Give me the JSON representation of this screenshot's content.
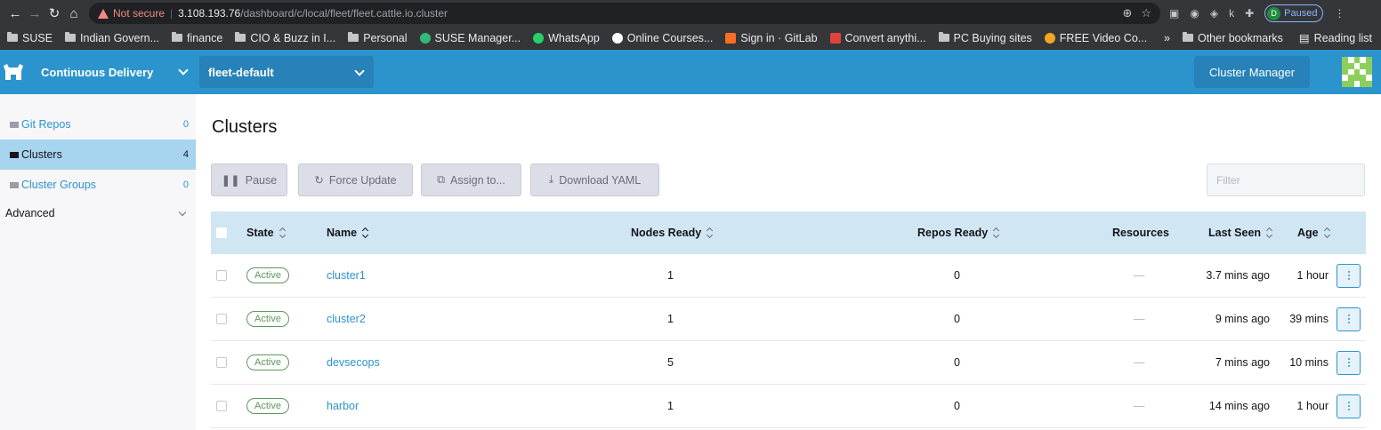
{
  "browser": {
    "not_secure": "Not secure",
    "url_host": "3.108.193.76",
    "url_path": "/dashboard/c/local/fleet/fleet.cattle.io.cluster",
    "profile_initial": "D",
    "profile_status": "Paused",
    "bookmarks": [
      "SUSE",
      "Indian Govern...",
      "finance",
      "CIO & Buzz in I...",
      "Personal",
      "SUSE Manager...",
      "WhatsApp",
      "Online Courses...",
      "Sign in · GitLab",
      "Convert anythi...",
      "PC Buying sites",
      "FREE Video Co..."
    ],
    "bookmarks_overflow": "»",
    "other_bookmarks": "Other bookmarks",
    "reading_list": "Reading list"
  },
  "header": {
    "product": "Continuous Delivery",
    "workspace": "fleet-default",
    "cluster_manager": "Cluster Manager"
  },
  "sidebar": {
    "items": [
      {
        "label": "Git Repos",
        "count": "0"
      },
      {
        "label": "Clusters",
        "count": "4"
      },
      {
        "label": "Cluster Groups",
        "count": "0"
      }
    ],
    "advanced": "Advanced"
  },
  "main": {
    "title": "Clusters",
    "actions": {
      "pause": "Pause",
      "force_update": "Force Update",
      "assign_to": "Assign to...",
      "download_yaml": "Download YAML"
    },
    "filter_placeholder": "Filter",
    "columns": {
      "state": "State",
      "name": "Name",
      "nodes_ready": "Nodes Ready",
      "repos_ready": "Repos Ready",
      "resources": "Resources",
      "last_seen": "Last Seen",
      "age": "Age"
    },
    "rows": [
      {
        "state": "Active",
        "name": "cluster1",
        "nodes_ready": "1",
        "repos_ready": "0",
        "resources": "—",
        "last_seen": "3.7 mins ago",
        "age": "1 hour"
      },
      {
        "state": "Active",
        "name": "cluster2",
        "nodes_ready": "1",
        "repos_ready": "0",
        "resources": "—",
        "last_seen": "9 mins ago",
        "age": "39 mins"
      },
      {
        "state": "Active",
        "name": "devsecops",
        "nodes_ready": "5",
        "repos_ready": "0",
        "resources": "—",
        "last_seen": "7 mins ago",
        "age": "10 mins"
      },
      {
        "state": "Active",
        "name": "harbor",
        "nodes_ready": "1",
        "repos_ready": "0",
        "resources": "—",
        "last_seen": "14 mins ago",
        "age": "1 hour"
      }
    ]
  },
  "colors": {
    "header_bg": "#2c94cd",
    "active_sidebar": "#a7d4ee",
    "table_header": "#d0e6f3",
    "active_badge": "#5d995d"
  }
}
